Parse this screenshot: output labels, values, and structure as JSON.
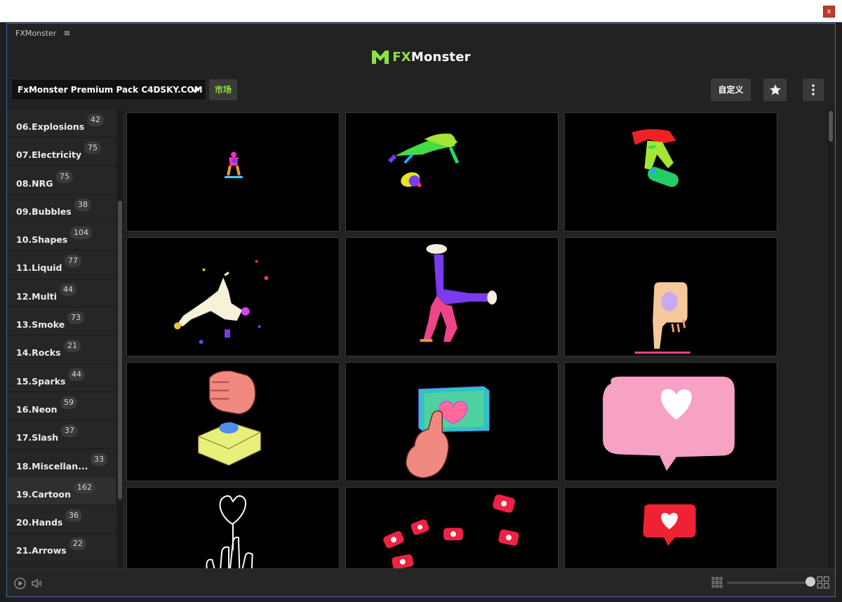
{
  "window": {
    "close_label": "x"
  },
  "panel": {
    "title": "FXMonster",
    "menu_icon": "hamburger-icon"
  },
  "brand": {
    "prefix": "FX",
    "suffix": "Monster",
    "accent": "#8fe33d"
  },
  "toolbar": {
    "pack_name": "FxMonster Premium Pack C4DSKY.COM",
    "market_label": "市场",
    "custom_label": "自定义",
    "star_icon": "star-icon",
    "more_icon": "more-vertical-icon"
  },
  "sidebar": {
    "items": [
      {
        "label": "06.Explosions",
        "count": "42"
      },
      {
        "label": "07.Electricity",
        "count": "75"
      },
      {
        "label": "08.NRG",
        "count": "75"
      },
      {
        "label": "09.Bubbles",
        "count": "38"
      },
      {
        "label": "10.Shapes",
        "count": "104"
      },
      {
        "label": "11.Liquid",
        "count": "77"
      },
      {
        "label": "12.Multi",
        "count": "44"
      },
      {
        "label": "13.Smoke",
        "count": "73"
      },
      {
        "label": "14.Rocks",
        "count": "21"
      },
      {
        "label": "15.Sparks",
        "count": "44"
      },
      {
        "label": "16.Neon",
        "count": "59"
      },
      {
        "label": "17.Slash",
        "count": "37"
      },
      {
        "label": "18.Miscellan...",
        "count": "33"
      },
      {
        "label": "19.Cartoon",
        "count": "162",
        "active": true
      },
      {
        "label": "20.Hands",
        "count": "36"
      },
      {
        "label": "21.Arrows",
        "count": "22"
      }
    ]
  },
  "grid": {
    "thumbnails": [
      "skater-small",
      "skater-flip",
      "skater-board-grab",
      "breakdancer-freeze",
      "handstand-dancer",
      "pointing-finger",
      "fist-press-button",
      "hand-touch-heart-box",
      "heart-speech-bubble",
      "heart-hand-outline",
      "heart-notifications",
      "heart-like-bubble"
    ]
  },
  "bottombar": {
    "play_icon": "play-circle-icon",
    "volume_icon": "volume-icon",
    "small_grid_icon": "small-grid-icon",
    "large_grid_icon": "large-grid-icon",
    "zoom_level": 1.0
  }
}
